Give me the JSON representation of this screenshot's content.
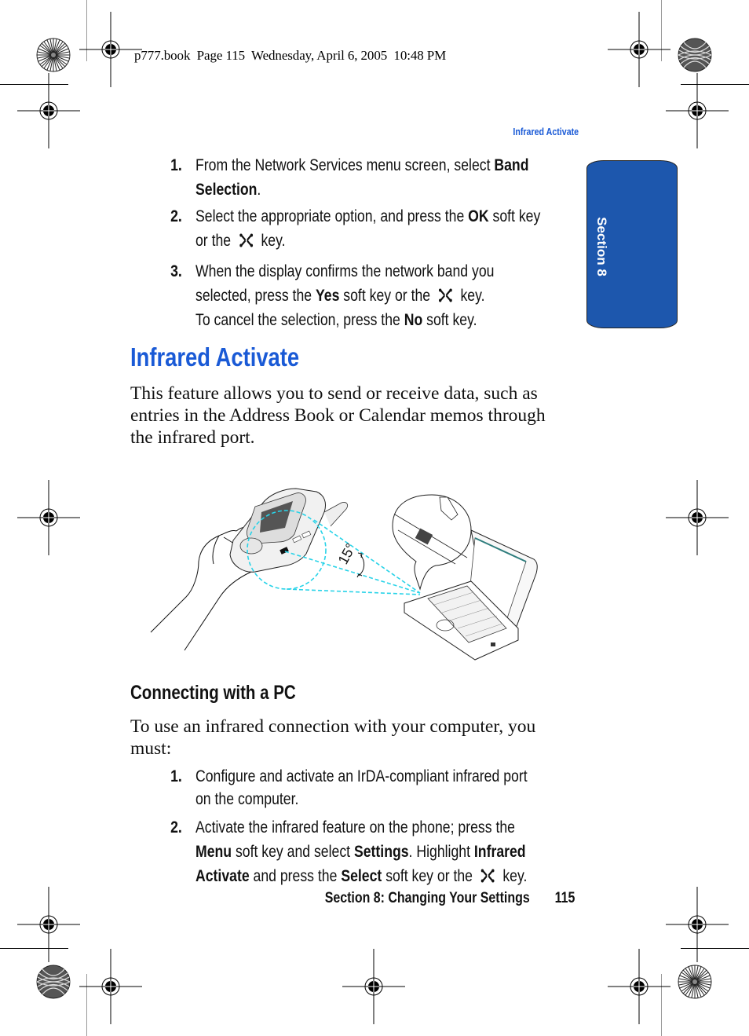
{
  "slug": "p777.book  Page 115  Wednesday, April 6, 2005  10:48 PM",
  "running_head": "Infrared Activate",
  "section_tab": {
    "label": "Section 8",
    "color": "#1d57ad"
  },
  "top_steps": [
    {
      "num": "1.",
      "lines": [
        [
          {
            "t": "From the Network Services menu screen, select "
          },
          {
            "b": "Band"
          }
        ],
        [
          {
            "b": "Selection"
          },
          {
            "t": "."
          }
        ]
      ]
    },
    {
      "num": "2.",
      "lines": [
        [
          {
            "t": "Select the appropriate option, and press the "
          },
          {
            "b": "OK"
          },
          {
            "t": " soft key"
          }
        ],
        [
          {
            "t": "or the "
          },
          {
            "icon": "key"
          },
          {
            "t": " key."
          }
        ]
      ]
    },
    {
      "num": "3.",
      "lines": [
        [
          {
            "t": "When the display confirms the network band you"
          }
        ],
        [
          {
            "t": "selected, press the "
          },
          {
            "b": "Yes"
          },
          {
            "t": " soft key or the "
          },
          {
            "icon": "key"
          },
          {
            "t": " key."
          }
        ],
        [
          {
            "t": "To cancel the selection, press the "
          },
          {
            "b": "No"
          },
          {
            "t": " soft key."
          }
        ]
      ]
    }
  ],
  "heading": "Infrared Activate",
  "intro_lines": [
    "This feature allows you to send or receive data, such as",
    "entries in the Address Book or Calendar memos through",
    "the infrared port."
  ],
  "figure": {
    "angle_label": "15°",
    "beam_color": "#29d3e8",
    "description": "Phone held in hand pointing infrared port at laptop"
  },
  "subheading": "Connecting with a PC",
  "pc_intro_lines": [
    "To use an infrared connection with your computer, you",
    "must:"
  ],
  "pc_steps": [
    {
      "num": "1.",
      "lines": [
        [
          {
            "t": "Configure and activate an IrDA-compliant infrared port"
          }
        ],
        [
          {
            "t": "on the computer."
          }
        ]
      ]
    },
    {
      "num": "2.",
      "lines": [
        [
          {
            "t": "Activate the infrared feature on the phone; press the"
          }
        ],
        [
          {
            "b": "Menu"
          },
          {
            "t": " soft key and select "
          },
          {
            "b": "Settings"
          },
          {
            "t": ". Highlight "
          },
          {
            "b": "Infrared"
          }
        ],
        [
          {
            "b": "Activate"
          },
          {
            "t": " and press the "
          },
          {
            "b": "Select"
          },
          {
            "t": " soft key or the "
          },
          {
            "icon": "key"
          },
          {
            "t": " key."
          }
        ]
      ]
    }
  ],
  "footer": {
    "section": "Section 8: Changing Your Settings",
    "page": "115"
  },
  "colors": {
    "accent_blue": "#1a5ad6",
    "tab_blue": "#1d57ad",
    "text": "#111111"
  }
}
